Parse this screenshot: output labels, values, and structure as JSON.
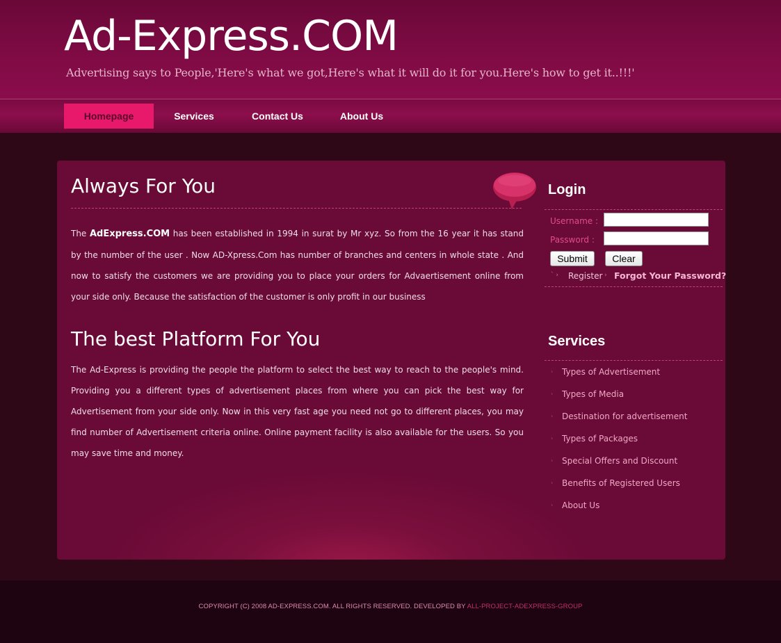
{
  "header": {
    "logo": "Ad-Express.COM",
    "tagline": "Advertising says to People,'Here's what we got,Here's what it will do it for you.Here's how to get it..!!!'"
  },
  "nav": {
    "items": [
      {
        "label": "Homepage",
        "active": true
      },
      {
        "label": "Services",
        "active": false
      },
      {
        "label": "Contact Us",
        "active": false
      },
      {
        "label": "About Us",
        "active": false
      }
    ]
  },
  "main": {
    "section1": {
      "title": "Always For You",
      "para_prefix": "The ",
      "para_bold": "AdExpress.COM",
      "para_rest": " has been established in 1994 in surat by Mr xyz. So from the 16 year it has stand by the number of the user . Now AD-Xpress.Com has number of branches and centers in whole state . And now to satisfy the customers we are providing you to place your orders for Advaertisement online from your side only. Because the satisfaction of the customer is only profit in our business"
    },
    "section2": {
      "title": "The best Platform For You",
      "para": "The Ad-Express is providing the people the platform to select the best way to reach to the people's mind. Providing you a different types of advertisement places from where you can pick the best way for Advertisement from your side only. Now in this very fast age you need not go to different places, you may find number of Advertisement criteria online. Online payment facility is also available for the users. So you may save time and money."
    }
  },
  "login": {
    "title": "Login",
    "username_label": "Username :",
    "username_value": "",
    "password_label": "Password :",
    "password_value": "",
    "submit_label": "Submit",
    "clear_label": "Clear",
    "register_label": "Register",
    "forgot_label": "Forgot Your Password?"
  },
  "services": {
    "title": "Services",
    "items": [
      "Types of Advertisement",
      "Types of Media",
      "Destination for advertisement",
      "Types of Packages",
      "Special Offers and Discount",
      "Benefits of Registered Users",
      "About Us"
    ]
  },
  "footer": {
    "text": "COPYRIGHT (C) 2008 AD-EXPRESS.COM. ALL RIGHTS RESERVED. DEVELOPED BY ",
    "link": "ALL-PROJECT-ADEXPRESS-GROUP"
  },
  "colors": {
    "accent": "#e8186a",
    "header_bg": "#800b45",
    "panel_bg": "#6a0a36",
    "page_bg": "#2e0817",
    "footer_bg": "#1d0410"
  }
}
